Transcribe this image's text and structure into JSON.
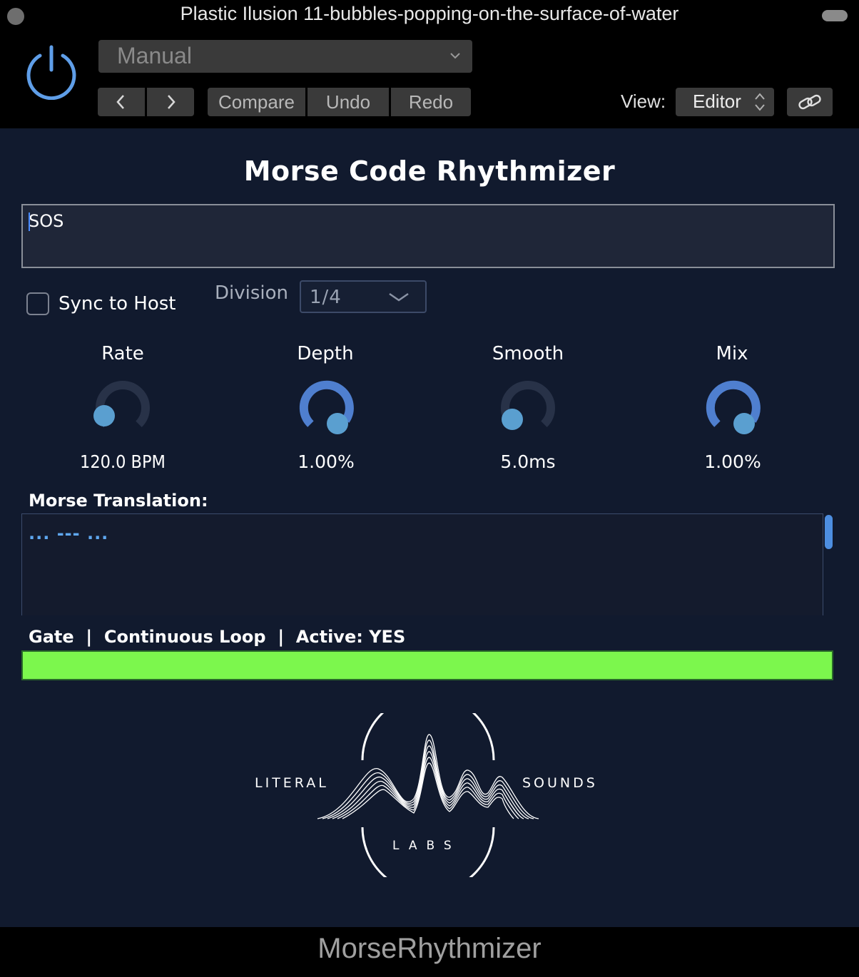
{
  "window": {
    "title": "Plastic Ilusion 11-bubbles-popping-on-the-surface-of-water"
  },
  "host": {
    "preset": "Manual",
    "compare": "Compare",
    "undo": "Undo",
    "redo": "Redo",
    "view_label": "View:",
    "view_value": "Editor"
  },
  "plugin": {
    "title": "Morse Code Rhythmizer",
    "text_input": "SOS",
    "sync_to_host": {
      "label": "Sync to Host",
      "checked": false
    },
    "division": {
      "label": "Division",
      "value": "1/4"
    },
    "knobs": [
      {
        "label": "Rate",
        "value": "120.0 BPM"
      },
      {
        "label": "Depth",
        "value": "1.00%"
      },
      {
        "label": "Smooth",
        "value": "5.0ms"
      },
      {
        "label": "Mix",
        "value": "1.00%"
      }
    ],
    "morse_translation": {
      "label": "Morse Translation:",
      "value": "... --- ..."
    },
    "status": {
      "mode": "Gate",
      "sep": "|",
      "loop": "Continuous Loop",
      "active": "Active: YES"
    },
    "accent_color": "#4f7fcf",
    "gate_color": "#7cf74d"
  },
  "logo": {
    "left": "LITERAL",
    "right": "SOUNDS",
    "bottom": "LABS"
  },
  "footer": {
    "name": "MorseRhythmizer"
  }
}
